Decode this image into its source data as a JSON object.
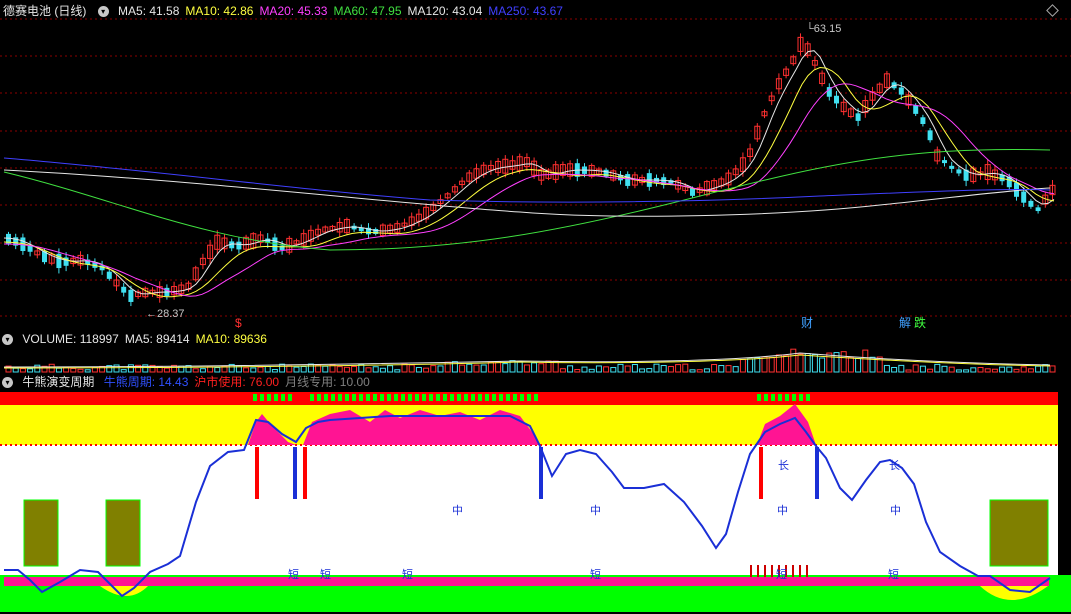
{
  "price_panel": {
    "stock_title": "德赛电池 (日线)",
    "ma_labels": [
      {
        "text": "MA5: 41.58",
        "color": "#e6e6e6"
      },
      {
        "text": "MA10: 42.86",
        "color": "#ffff40"
      },
      {
        "text": "MA20: 45.33",
        "color": "#ff40ff"
      },
      {
        "text": "MA60: 47.95",
        "color": "#40e040"
      },
      {
        "text": "MA120: 43.04",
        "color": "#e6e6e6"
      },
      {
        "text": "MA250: 43.67",
        "color": "#4040ff"
      }
    ],
    "high_label": "63.15",
    "low_label": "28.37",
    "markers": [
      {
        "text": "$",
        "color": "#ff3030"
      },
      {
        "text": "财",
        "color": "#40a0ff"
      },
      {
        "text": "解",
        "color": "#40a0ff"
      },
      {
        "text": "跌",
        "color": "#40ff40"
      }
    ]
  },
  "volume_panel": {
    "labels": [
      {
        "text": "VOLUME: 118997",
        "color": "#e6e6e6"
      },
      {
        "text": "MA5: 89414",
        "color": "#e6e6e6"
      },
      {
        "text": "MA10: 89636",
        "color": "#ffff40"
      }
    ]
  },
  "indicator_panel": {
    "title": "牛熊演变周期",
    "labels": [
      {
        "text": "牛熊周期: 14.43",
        "color": "#3050ff"
      },
      {
        "text": "沪市使用: 76.00",
        "color": "#ff2020"
      },
      {
        "text": "月线专用: 10.00",
        "color": "#808080"
      }
    ],
    "zone_marks": {
      "long": "长",
      "mid": "中",
      "short": "短"
    }
  },
  "colors": {
    "up": "#ff3030",
    "down": "#40e0f0",
    "grid": "#8b0000",
    "indicator_line": "#1a2fd6",
    "magenta": "#ff1493",
    "yellow": "#ffff00",
    "green": "#00ff00",
    "olive": "#808000"
  },
  "icons": [
    "collapse-circle-icon",
    "options-diamond-icon"
  ]
}
